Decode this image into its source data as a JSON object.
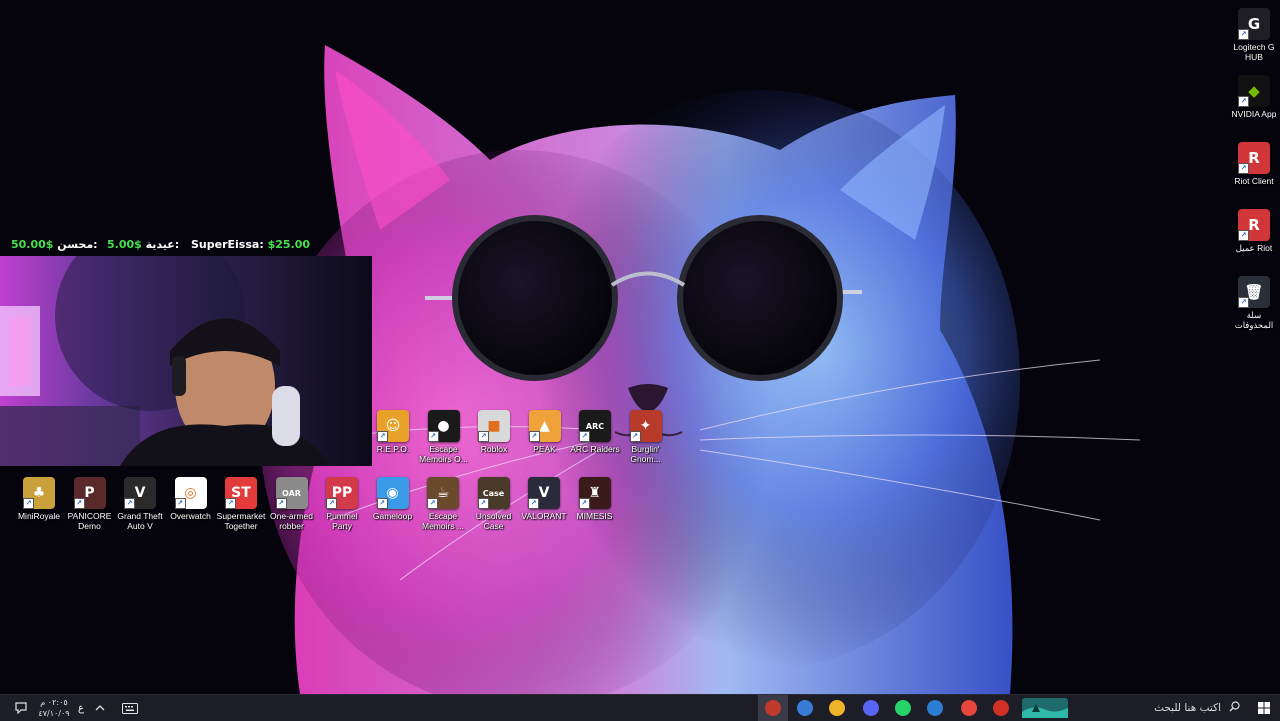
{
  "desktop": {
    "right_icons": [
      {
        "label": "Logitech G HUB",
        "icon": "logitech-g-hub-icon",
        "color": "#ffffff",
        "bg": "#1e1e24"
      },
      {
        "label": "NVIDIA App",
        "icon": "nvidia-icon",
        "color": "#76b900",
        "bg": "#111111"
      },
      {
        "label": "Riot Client",
        "icon": "riot-client-icon",
        "color": "#ffffff",
        "bg": "#d13639"
      },
      {
        "label": "عميل Riot",
        "icon": "riot-client-icon",
        "color": "#ffffff",
        "bg": "#d13639"
      },
      {
        "label": "سلة المحذوفات",
        "icon": "recycle-bin-icon",
        "color": "#ffffff",
        "bg": "#2a2f3a"
      }
    ],
    "row1_icons": [
      {
        "label": "R.E.P.O.",
        "icon": "repo-game-icon",
        "glyph": "☺",
        "bg": "#e8a22a"
      },
      {
        "label": "Escape Memoirs O...",
        "icon": "escape-memoirs-icon",
        "glyph": "●",
        "bg": "#1a1a1a"
      },
      {
        "label": "Roblox",
        "icon": "roblox-icon",
        "glyph": "■",
        "bg": "#d9d9d9"
      },
      {
        "label": "PEAK",
        "icon": "peak-game-icon",
        "glyph": "▲",
        "bg": "#f0a23a"
      },
      {
        "label": "ARC Raiders",
        "icon": "arc-raiders-icon",
        "glyph": "ARC",
        "bg": "#1a1a1a"
      },
      {
        "label": "Burglin' Gnom...",
        "icon": "burglin-gnomes-icon",
        "glyph": "✦",
        "bg": "#b83a2a"
      }
    ],
    "row2_icons": [
      {
        "label": "MiniRoyale",
        "icon": "miniroyale-icon",
        "glyph": "♣",
        "bg": "#c9a03a"
      },
      {
        "label": "PANICORE Demo",
        "icon": "panicore-icon",
        "glyph": "P",
        "bg": "#5a2a2a"
      },
      {
        "label": "Grand Theft Auto V",
        "icon": "gta-v-icon",
        "glyph": "V",
        "bg": "#2a2a2a"
      },
      {
        "label": "Overwatch",
        "icon": "overwatch-icon",
        "glyph": "◎",
        "bg": "#ffffff"
      },
      {
        "label": "Supermarket Together",
        "icon": "supermarket-together-icon",
        "glyph": "ST",
        "bg": "#e33a3a"
      },
      {
        "label": "One-armed robber",
        "icon": "one-armed-robber-icon",
        "glyph": "OAR",
        "bg": "#8a8a8a"
      },
      {
        "label": "Pummel Party",
        "icon": "pummel-party-icon",
        "glyph": "PP",
        "bg": "#d23a4a"
      },
      {
        "label": "Gameloop",
        "icon": "gameloop-icon",
        "glyph": "◉",
        "bg": "#3a9ae8"
      },
      {
        "label": "Escape Memoirs ...",
        "icon": "escape-memoirs-icon",
        "glyph": "☕",
        "bg": "#6a4a2a"
      },
      {
        "label": "Unsolved Case",
        "icon": "unsolved-case-icon",
        "glyph": "Case",
        "bg": "#4a3a2a"
      },
      {
        "label": "VALORANT",
        "icon": "valorant-icon",
        "glyph": "V",
        "bg": "#2a2a3a"
      },
      {
        "label": "MIMESIS",
        "icon": "mimesis-icon",
        "glyph": "♜",
        "bg": "#3a1a1a"
      }
    ]
  },
  "donations": [
    {
      "name": "محسن:",
      "amount": "50.00$"
    },
    {
      "name": "عيدية:",
      "amount": "5.00$"
    },
    {
      "name": "SuperEissa:",
      "amount": "$25.00"
    }
  ],
  "taskbar": {
    "search_placeholder": "اكتب هنا للبحث",
    "clock_time": "٠٢:٠٥ م",
    "clock_date": "٤٧/١٠/٠٩",
    "lang": "ع",
    "apps": [
      {
        "icon": "obs-icon",
        "color": "#c0392b",
        "active": true
      },
      {
        "icon": "streamdeck-icon",
        "color": "#3a7bd5",
        "active": false
      },
      {
        "icon": "folder-icon",
        "color": "#f0b429",
        "active": false
      },
      {
        "icon": "discord-icon",
        "color": "#5865f2",
        "active": false
      },
      {
        "icon": "whatsapp-icon",
        "color": "#25d366",
        "active": false
      },
      {
        "icon": "mail-icon",
        "color": "#2b7cd3",
        "active": false
      },
      {
        "icon": "chrome-icon",
        "color": "#e8453c",
        "active": false
      },
      {
        "icon": "app-badge-icon",
        "color": "#d22f27",
        "active": false
      }
    ]
  }
}
